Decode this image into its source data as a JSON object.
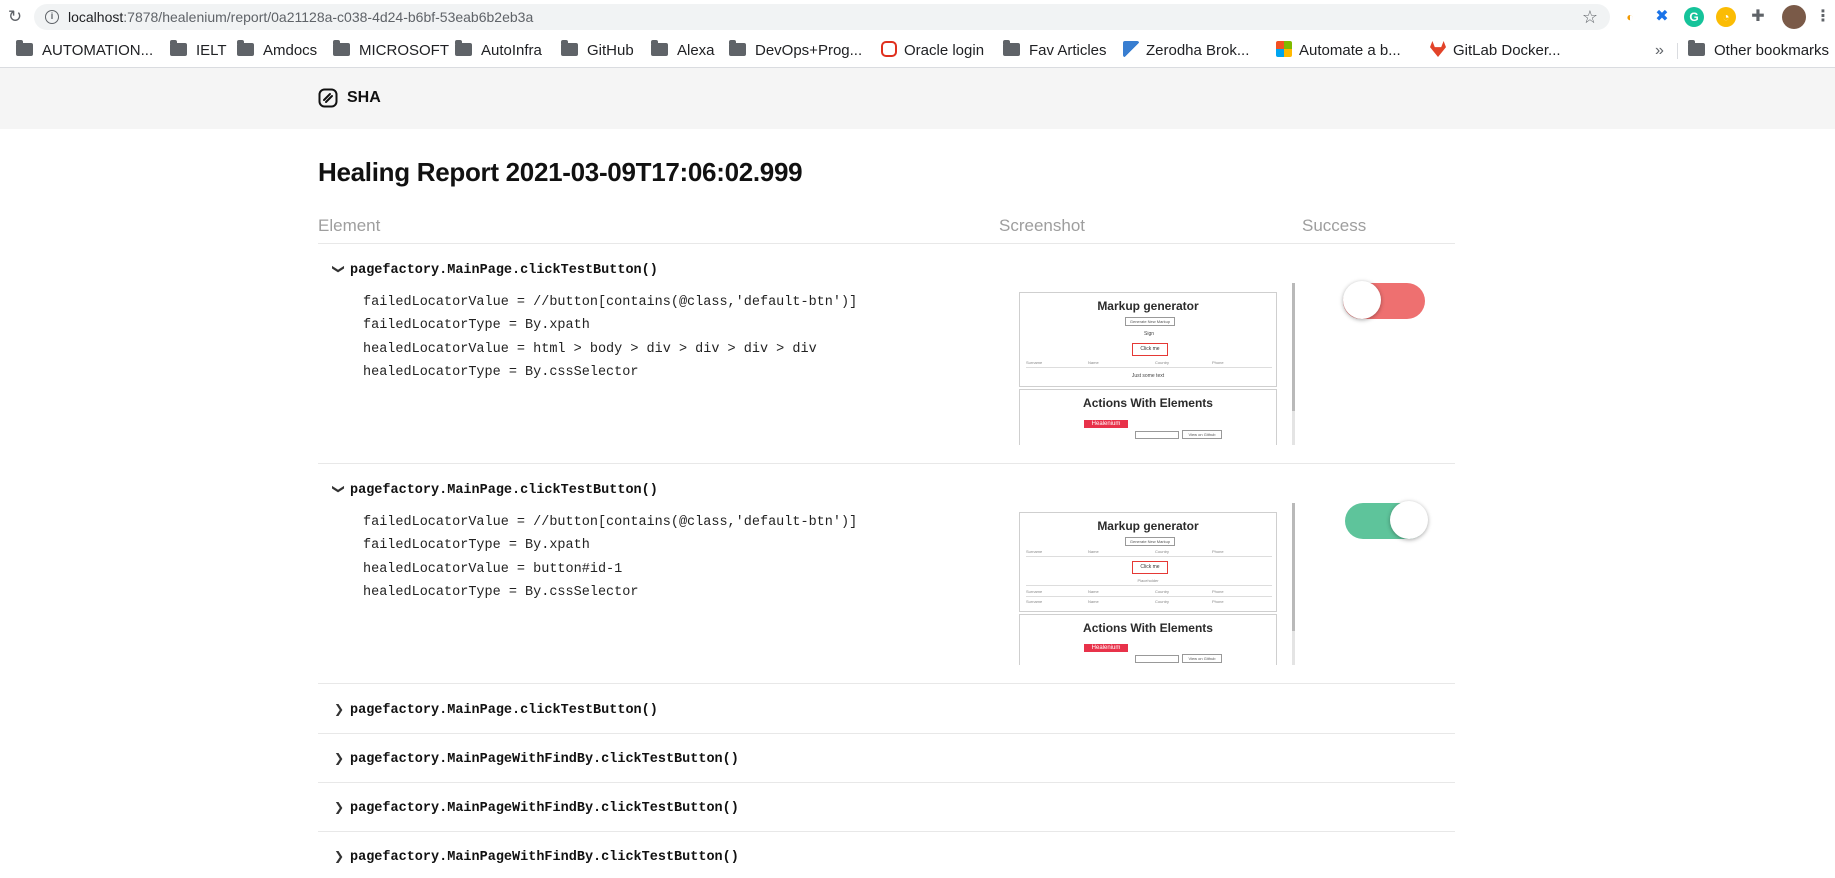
{
  "browser": {
    "url_host": "localhost",
    "url_rest": ":7878/healenium/report/0a21128a-c038-4d24-b6bf-53eab6b2eb3a",
    "bookmarks": [
      {
        "label": "AUTOMATION...",
        "icon": "folder-icon"
      },
      {
        "label": "IELT",
        "icon": "folder-icon"
      },
      {
        "label": "Amdocs",
        "icon": "folder-icon"
      },
      {
        "label": "MICROSOFT",
        "icon": "folder-icon"
      },
      {
        "label": "AutoInfra",
        "icon": "folder-icon"
      },
      {
        "label": "GitHub",
        "icon": "folder-icon"
      },
      {
        "label": "Alexa",
        "icon": "folder-icon"
      },
      {
        "label": "DevOps+Prog...",
        "icon": "folder-icon"
      },
      {
        "label": "Oracle login",
        "icon": "oracle-icon"
      },
      {
        "label": "Fav Articles",
        "icon": "folder-icon"
      },
      {
        "label": "Zerodha Brok...",
        "icon": "zerodha-icon"
      },
      {
        "label": "Automate a b...",
        "icon": "microsoft-icon"
      },
      {
        "label": "GitLab Docker...",
        "icon": "gitlab-icon"
      }
    ],
    "more_bookmarks": "»",
    "other_bookmarks": "Other bookmarks"
  },
  "header": {
    "logo_text": "SHA"
  },
  "report": {
    "title": "Healing Report 2021-03-09T17:06:02.999",
    "columns": {
      "element": "Element",
      "screenshot": "Screenshot",
      "success": "Success"
    },
    "expanded_rows": [
      {
        "title": "pagefactory.MainPage.clickTestButton()",
        "lines": [
          "failedLocatorValue = //button[contains(@class,'default-btn')]",
          "failedLocatorType = By.xpath",
          "healedLocatorValue = html > body > div > div > div > div",
          "healedLocatorType = By.cssSelector"
        ],
        "success": false
      },
      {
        "title": "pagefactory.MainPage.clickTestButton()",
        "lines": [
          "failedLocatorValue = //button[contains(@class,'default-btn')]",
          "failedLocatorType = By.xpath",
          "healedLocatorValue = button#id-1",
          "healedLocatorType = By.cssSelector"
        ],
        "success": true
      }
    ],
    "collapsed_rows": [
      "pagefactory.MainPage.clickTestButton()",
      "pagefactory.MainPageWithFindBy.clickTestButton()",
      "pagefactory.MainPageWithFindBy.clickTestButton()",
      "pagefactory.MainPageWithFindBy.clickTestButton()"
    ],
    "shot": {
      "markup_title": "Markup generator",
      "generate_btn": "Generate New Markup",
      "sign": "Sign",
      "click_me": "Click me",
      "cols": [
        "Surname",
        "Name",
        "Country",
        "Phone"
      ],
      "just_text": "Just some text",
      "actions_title": "Actions With Elements",
      "mini_logo": "Healenium",
      "view_btn": "View on Github",
      "placeholder": "Placeholder"
    }
  },
  "colors": {
    "toggle_off": "#ee7070",
    "toggle_on": "#5ec49b"
  }
}
